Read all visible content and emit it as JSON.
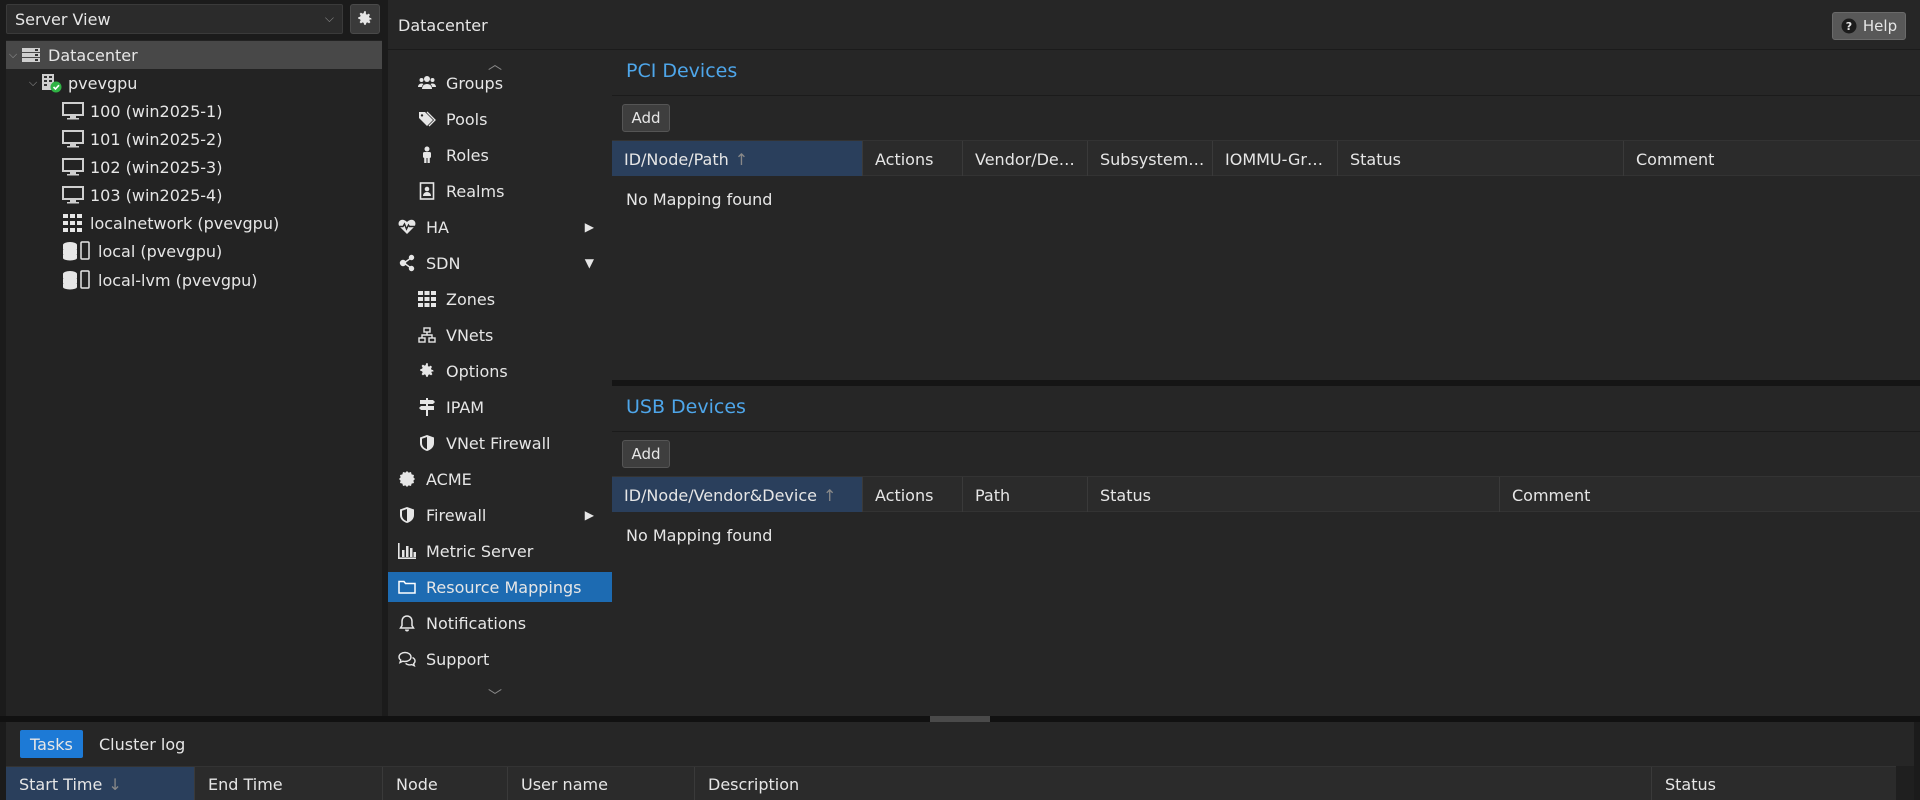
{
  "left": {
    "view_select": "Server View",
    "tree": [
      {
        "label": "Datacenter",
        "icon": "datacenter-icon",
        "selected": true
      },
      {
        "label": "pvevgpu",
        "icon": "node-icon"
      },
      {
        "label": "100 (win2025-1)",
        "icon": "vm-icon"
      },
      {
        "label": "101 (win2025-2)",
        "icon": "vm-icon"
      },
      {
        "label": "102 (win2025-3)",
        "icon": "vm-icon"
      },
      {
        "label": "103 (win2025-4)",
        "icon": "vm-icon"
      },
      {
        "label": "localnetwork (pvevgpu)",
        "icon": "network-grid-icon"
      },
      {
        "label": "local (pvevgpu)",
        "icon": "storage-icon"
      },
      {
        "label": "local-lvm (pvevgpu)",
        "icon": "storage-icon"
      }
    ]
  },
  "header": {
    "title": "Datacenter",
    "help_label": "Help"
  },
  "menu": {
    "items": [
      {
        "label": "Groups",
        "icon": "users-icon",
        "level": 1
      },
      {
        "label": "Pools",
        "icon": "tags-icon",
        "level": 1
      },
      {
        "label": "Roles",
        "icon": "male-icon",
        "level": 1
      },
      {
        "label": "Realms",
        "icon": "address-book-icon",
        "level": 1
      },
      {
        "label": "HA",
        "icon": "heartbeat-icon",
        "level": 0,
        "arrow": "right"
      },
      {
        "label": "SDN",
        "icon": "sdn-icon",
        "level": 0,
        "arrow": "down"
      },
      {
        "label": "Zones",
        "icon": "grid-icon",
        "level": 1
      },
      {
        "label": "VNets",
        "icon": "sitemap-icon",
        "level": 1
      },
      {
        "label": "Options",
        "icon": "gear-icon",
        "level": 1
      },
      {
        "label": "IPAM",
        "icon": "signpost-icon",
        "level": 1
      },
      {
        "label": "VNet Firewall",
        "icon": "shield-icon",
        "level": 1
      },
      {
        "label": "ACME",
        "icon": "certificate-icon",
        "level": 0
      },
      {
        "label": "Firewall",
        "icon": "shield-icon",
        "level": 0,
        "arrow": "right"
      },
      {
        "label": "Metric Server",
        "icon": "bar-chart-icon",
        "level": 0
      },
      {
        "label": "Resource Mappings",
        "icon": "folder-icon",
        "level": 0,
        "active": true
      },
      {
        "label": "Notifications",
        "icon": "bell-icon",
        "level": 0
      },
      {
        "label": "Support",
        "icon": "comments-icon",
        "level": 0
      }
    ]
  },
  "pci": {
    "title": "PCI Devices",
    "add_label": "Add",
    "columns": [
      "ID/Node/Path",
      "Actions",
      "Vendor/De…",
      "Subsystem…",
      "IOMMU-Gr…",
      "Status",
      "Comment"
    ],
    "empty_text": "No Mapping found"
  },
  "usb": {
    "title": "USB Devices",
    "add_label": "Add",
    "columns": [
      "ID/Node/Vendor&Device",
      "Actions",
      "Path",
      "Status",
      "Comment"
    ],
    "empty_text": "No Mapping found"
  },
  "bottom": {
    "tabs": [
      "Tasks",
      "Cluster log"
    ],
    "columns": [
      "Start Time",
      "End Time",
      "Node",
      "User name",
      "Description",
      "Status"
    ]
  },
  "colors": {
    "accent": "#1d6bb2",
    "title_blue": "#4ea6ea",
    "status_ok": "#2fb344"
  }
}
